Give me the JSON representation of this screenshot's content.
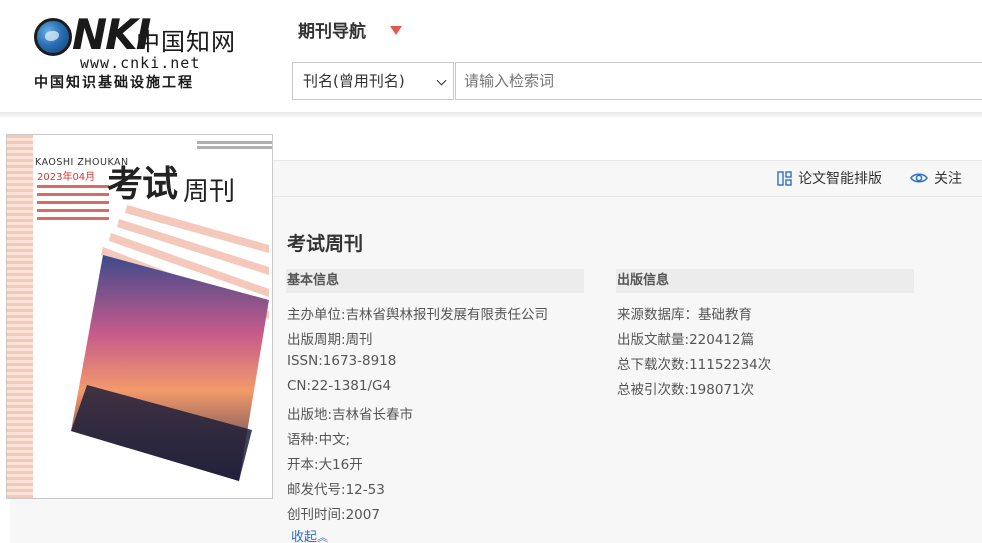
{
  "logo": {
    "letters": "CNKI",
    "chinese": "中国知网",
    "url": "www.cnki.net",
    "tagline": "中国知识基础设施工程"
  },
  "nav": {
    "title": "期刊导航"
  },
  "search": {
    "field_value": "刊名(曾用刊名)",
    "placeholder": "请输入检索词"
  },
  "toolbar": {
    "layout_label": "论文智能排版",
    "follow_label": "关注"
  },
  "journal": {
    "title": "考试周刊"
  },
  "basic_info": {
    "heading": "基本信息",
    "rows": [
      {
        "label": "主办单位:",
        "value": "吉林省舆林报刊发展有限责任公司"
      },
      {
        "label": "出版周期:",
        "value": "周刊"
      },
      {
        "label": "ISSN:",
        "value": "1673-8918"
      },
      {
        "label": "CN:",
        "value": "22-1381/G4"
      },
      {
        "label": "出版地:",
        "value": "吉林省长春市"
      },
      {
        "label": "语种:",
        "value": "中文;"
      },
      {
        "label": "开本:",
        "value": "大16开"
      },
      {
        "label": "邮发代号:",
        "value": "12-53"
      },
      {
        "label": "创刊时间:",
        "value": "2007"
      }
    ],
    "collapse_label": "收起"
  },
  "publish_info": {
    "heading": "出版信息",
    "rows": [
      {
        "label": "来源数据库：",
        "value": "基础教育"
      },
      {
        "label": "出版文献量:",
        "value": "220412篇"
      },
      {
        "label": "总下载次数:",
        "value": "11152234次"
      },
      {
        "label": "总被引次数:",
        "value": "198071次"
      }
    ]
  },
  "cover": {
    "pinyin": "KAOSHI ZHOUKAN",
    "issue": "2023年04月",
    "name_main": "考试",
    "name_sub": "周刊"
  },
  "colors": {
    "accent_red": "#e8574b",
    "link_blue": "#2f6fc5",
    "icon_blue": "#2f6fc5"
  },
  "icons": {
    "caret": "caret-down-icon",
    "select_chevron": "chevron-down-icon",
    "layout": "layout-grid-icon",
    "follow": "eye-icon",
    "collapse": "double-chevron-up-icon"
  }
}
